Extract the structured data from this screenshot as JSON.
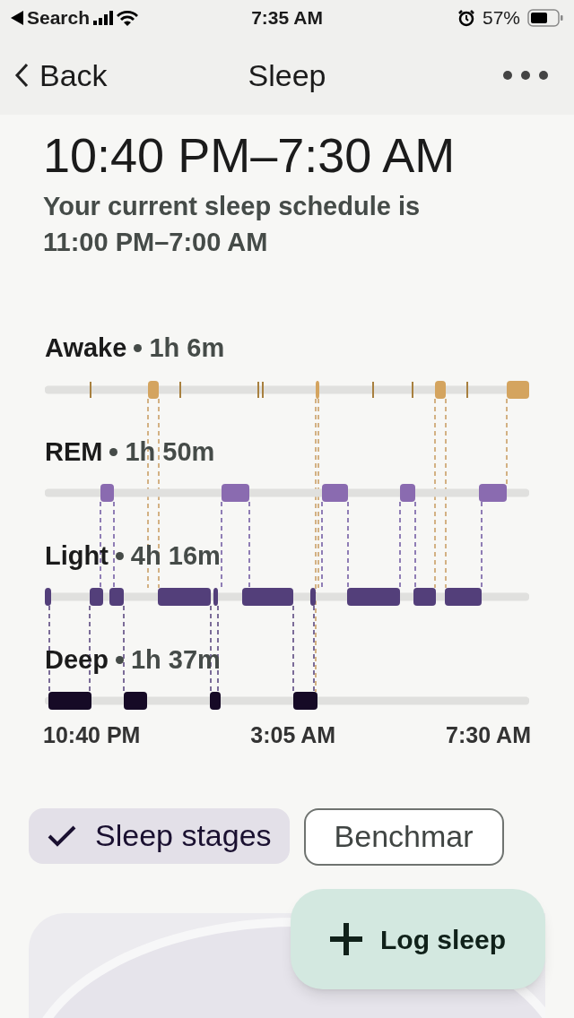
{
  "status_bar": {
    "back_app": "Search",
    "time": "7:35 AM",
    "battery": "57%"
  },
  "nav": {
    "back": "Back",
    "title": "Sleep"
  },
  "header": {
    "time_range": "10:40 PM–7:30 AM",
    "schedule": "Your current sleep schedule is 11:00 PM–7:00 AM"
  },
  "stages": [
    {
      "name": "Awake",
      "duration": "1h 6m"
    },
    {
      "name": "REM",
      "duration": "1h 50m"
    },
    {
      "name": "Light",
      "duration": "4h 16m"
    },
    {
      "name": "Deep",
      "duration": "1h 37m"
    }
  ],
  "axis_labels": [
    "10:40 PM",
    "3:05 AM",
    "7:30 AM"
  ],
  "chips": [
    {
      "label": "Sleep stages",
      "selected": true
    },
    {
      "label": "Benchmar",
      "selected": false
    }
  ],
  "fab": {
    "label": "Log sleep"
  }
}
